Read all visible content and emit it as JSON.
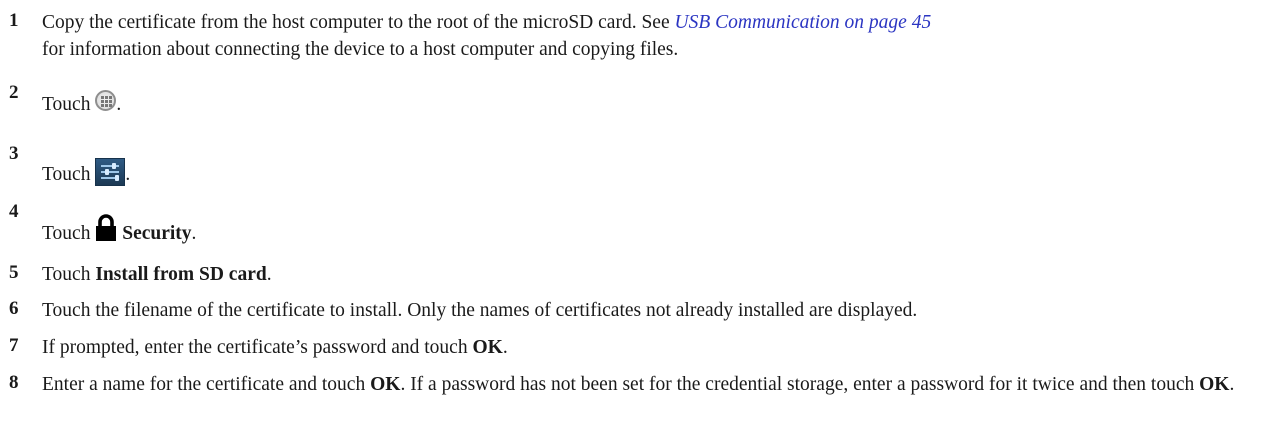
{
  "steps": [
    {
      "num": "1",
      "before": "Copy the certificate from the host computer to the root of the microSD card. See ",
      "link": "USB Communication on page 45",
      "after": "for information about connecting the device to a host computer and copying files."
    },
    {
      "num": "2",
      "before": "Touch ",
      "icon": "apps-icon",
      "after": "."
    },
    {
      "num": "3",
      "before": "Touch ",
      "icon": "settings-icon",
      "after": "."
    },
    {
      "num": "4",
      "before": "Touch ",
      "icon": "lock-icon",
      "bold": "Security",
      "after": "."
    },
    {
      "num": "5",
      "before": "Touch ",
      "bold": "Install from SD card",
      "after": "."
    },
    {
      "num": "6",
      "text": "Touch the filename of the certificate to install. Only the names of certificates not already installed are displayed."
    },
    {
      "num": "7",
      "before": "If prompted, enter the certificate’s password and touch ",
      "bold": "OK",
      "after": "."
    },
    {
      "num": "8",
      "before": "Enter a name for the certificate and touch ",
      "bold": "OK",
      "middle": ". If a password has not been set for the credential storage, enter a password for it twice and then touch ",
      "bold2": "OK",
      "after": "."
    }
  ],
  "colors": {
    "link": "#2b35c2",
    "text": "#1a1a1a"
  }
}
